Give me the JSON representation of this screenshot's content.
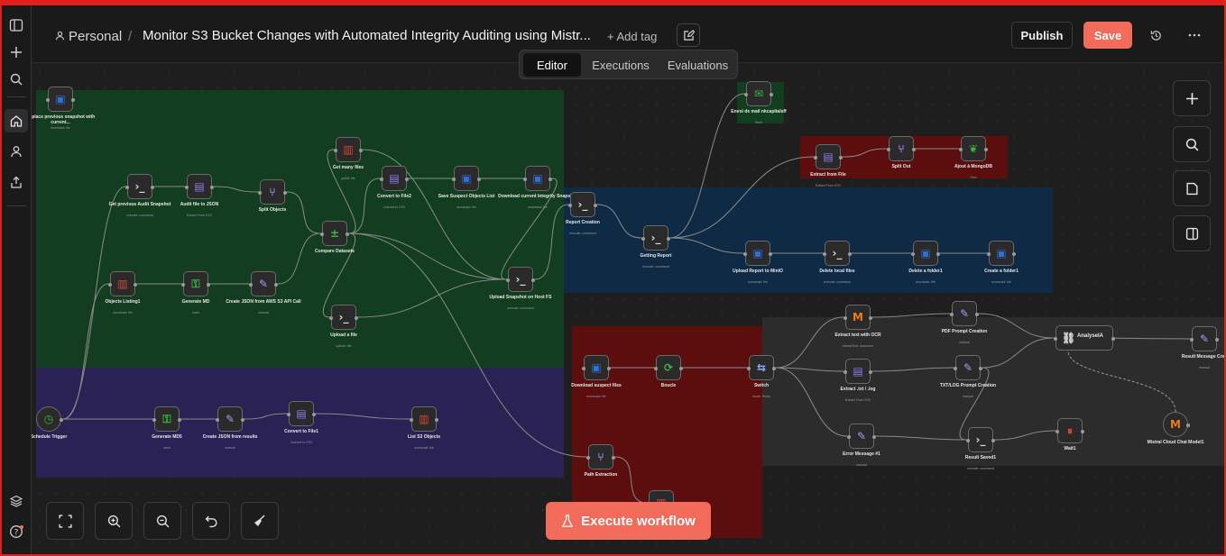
{
  "breadcrumb": {
    "project": "Personal",
    "separator": "/",
    "workflow_title": "Monitor S3 Bucket Changes with Automated Integrity Auditing using Mistr...",
    "add_tag": "+ Add tag"
  },
  "header": {
    "publish": "Publish",
    "save": "Save"
  },
  "tabs": [
    "Editor",
    "Executions",
    "Evaluations"
  ],
  "execute": "Execute workflow",
  "colors": {
    "accent": "#f26b5b",
    "sticky_green": "#123d1f",
    "sticky_purple": "#2a2155",
    "sticky_blue": "#0e2a44",
    "sticky_red": "#5c0d0d",
    "sticky_gray": "#2c2c2c"
  },
  "nodes": [
    {
      "id": "replace",
      "label": "Replace previous snapshot with current...",
      "sub": "download: file",
      "icon": "bucket-icon",
      "glyph": "▣",
      "color": "#2f6fd6"
    },
    {
      "id": "getprev",
      "label": "Get previous Audit Snapshot",
      "sub": "execute: command",
      "icon": "terminal-icon",
      "glyph": "›_",
      "color": "#dcdcdc"
    },
    {
      "id": "auditjson",
      "label": "Audit file to JSON",
      "sub": "Extract From CSV",
      "icon": "extract-icon",
      "glyph": "▤",
      "color": "#8e7cf0"
    },
    {
      "id": "split",
      "label": "Split Objects",
      "sub": "",
      "icon": "split-icon",
      "glyph": "⑂",
      "color": "#a27cf0"
    },
    {
      "id": "getmany",
      "label": "Get many files",
      "sub": "getAll: file",
      "icon": "aws-icon",
      "glyph": "▥",
      "color": "#d9443a"
    },
    {
      "id": "conv2",
      "label": "Convert to File2",
      "sub": "Convert to CSV",
      "icon": "file-icon",
      "glyph": "▤",
      "color": "#8e7cf0"
    },
    {
      "id": "savesusp",
      "label": "Save Suspect Objects List",
      "sub": "download: file",
      "icon": "bucket-icon",
      "glyph": "▣",
      "color": "#2f6fd6"
    },
    {
      "id": "dlcurrent",
      "label": "Download current Integrity Snapshot",
      "sub": "download: file",
      "icon": "bucket-icon",
      "glyph": "▣",
      "color": "#2f6fd6"
    },
    {
      "id": "compare",
      "label": "Compare Datasets",
      "sub": "",
      "icon": "compare-icon",
      "glyph": "±",
      "color": "#3ab54a"
    },
    {
      "id": "objlist",
      "label": "Objects Listing1",
      "sub": "download: file",
      "icon": "aws-icon",
      "glyph": "▥",
      "color": "#d9443a"
    },
    {
      "id": "genmd",
      "label": "Generate MD",
      "sub": "hash",
      "icon": "key-icon",
      "glyph": "⚿",
      "color": "#3ab54a"
    },
    {
      "id": "createjson",
      "label": "Create JSON from AWS S3 API Call",
      "sub": "manual",
      "icon": "pen-icon",
      "glyph": "✎",
      "color": "#a49cf5"
    },
    {
      "id": "uploadsnap",
      "label": "Upload Snapshot on Host FS",
      "sub": "execute: command",
      "icon": "terminal-icon",
      "glyph": "›_",
      "color": "#dcdcdc"
    },
    {
      "id": "uploadfile",
      "label": "Upload a file",
      "sub": "upload: file",
      "icon": "terminal-icon",
      "glyph": "›_",
      "color": "#dcdcdc"
    },
    {
      "id": "schedule",
      "label": "Schedule Trigger",
      "sub": "",
      "icon": "clock-icon",
      "glyph": "◷",
      "color": "#3ab54a"
    },
    {
      "id": "genmd5",
      "label": "Generate MD5",
      "sub": "hash",
      "icon": "key-icon",
      "glyph": "⚿",
      "color": "#3ab54a"
    },
    {
      "id": "createjson2",
      "label": "Create JSON from results",
      "sub": "manual",
      "icon": "pen-icon",
      "glyph": "✎",
      "color": "#a49cf5"
    },
    {
      "id": "conv1",
      "label": "Convert to File1",
      "sub": "Convert to CSV",
      "icon": "file-icon",
      "glyph": "▤",
      "color": "#8e7cf0"
    },
    {
      "id": "lists3",
      "label": "List S3 Objects",
      "sub": "download: file",
      "icon": "aws-icon",
      "glyph": "▥",
      "color": "#d9443a"
    },
    {
      "id": "envoi",
      "label": "Envoi de mail nkcapitalsff",
      "sub": "Send",
      "icon": "mail-icon",
      "glyph": "✉",
      "color": "#3ab54a"
    },
    {
      "id": "extractfile",
      "label": "Extract from File",
      "sub": "Extract From CSV",
      "icon": "extract-icon",
      "glyph": "▤",
      "color": "#8e7cf0"
    },
    {
      "id": "splitout",
      "label": "Split Out",
      "sub": "",
      "icon": "split-icon",
      "glyph": "⑂",
      "color": "#a27cf0"
    },
    {
      "id": "mongo",
      "label": "Ajout à MongoDB",
      "sub": "Find",
      "icon": "leaf-icon",
      "glyph": "❦",
      "color": "#3ab54a"
    },
    {
      "id": "report",
      "label": "Report Creation",
      "sub": "execute: command",
      "icon": "terminal-icon",
      "glyph": "›_",
      "color": "#dcdcdc"
    },
    {
      "id": "getreport",
      "label": "Getting Report",
      "sub": "execute: command",
      "icon": "terminal-icon",
      "glyph": "›_",
      "color": "#dcdcdc"
    },
    {
      "id": "uploadminio",
      "label": "Upload Report to MiniO",
      "sub": "download: file",
      "icon": "bucket-icon",
      "glyph": "▣",
      "color": "#2f6fd6"
    },
    {
      "id": "dellocal",
      "label": "Delete local files",
      "sub": "execute: command",
      "icon": "terminal-icon",
      "glyph": "›_",
      "color": "#dcdcdc"
    },
    {
      "id": "delfolder",
      "label": "Delete a folder1",
      "sub": "download: file",
      "icon": "bucket-icon",
      "glyph": "▣",
      "color": "#2f6fd6"
    },
    {
      "id": "createfolder",
      "label": "Create a folder1",
      "sub": "download: file",
      "icon": "bucket-icon",
      "glyph": "▣",
      "color": "#2f6fd6"
    },
    {
      "id": "dlsuspect",
      "label": "Download suspect files",
      "sub": "download: file",
      "icon": "bucket-icon",
      "glyph": "▣",
      "color": "#2f6fd6"
    },
    {
      "id": "boucle",
      "label": "Boucle",
      "sub": "",
      "icon": "loop-icon",
      "glyph": "⟳",
      "color": "#3ab54a"
    },
    {
      "id": "switch",
      "label": "Switch",
      "sub": "mode: Rules",
      "icon": "switch-icon",
      "glyph": "⇆",
      "color": "#8aa8ff"
    },
    {
      "id": "ocr",
      "label": "Extract text with OCR",
      "sub": "extractText: document",
      "icon": "mistral-icon",
      "glyph": "M",
      "color": "#f07a1a"
    },
    {
      "id": "txtlog",
      "label": "Extract .txt / .log",
      "sub": "Extract From CSV",
      "icon": "extract-icon",
      "glyph": "▤",
      "color": "#8e7cf0"
    },
    {
      "id": "pdfprompt",
      "label": "PDF Prompt Creation",
      "sub": "manual",
      "icon": "pen-icon",
      "glyph": "✎",
      "color": "#a49cf5"
    },
    {
      "id": "txtprompt",
      "label": "TXT/LOG Prompt Creation",
      "sub": "manual",
      "icon": "pen-icon",
      "glyph": "✎",
      "color": "#a49cf5"
    },
    {
      "id": "analysis",
      "label": "AnalyseIA",
      "sub": "",
      "icon": "link-icon",
      "glyph": "⛓",
      "color": "#dcdcdc"
    },
    {
      "id": "result",
      "label": "Result Message Crea",
      "sub": "manual",
      "icon": "pen-icon",
      "glyph": "✎",
      "color": "#a49cf5"
    },
    {
      "id": "mistral",
      "label": "Mistral Cloud Chat Model1",
      "sub": "",
      "icon": "mistral-icon",
      "glyph": "M",
      "color": "#f07a1a"
    },
    {
      "id": "errmsg",
      "label": "Error Message #1",
      "sub": "manual",
      "icon": "pen-icon",
      "glyph": "✎",
      "color": "#a49cf5"
    },
    {
      "id": "resultsaved",
      "label": "Result Saved1",
      "sub": "execute: command",
      "icon": "terminal-icon",
      "glyph": "›_",
      "color": "#dcdcdc"
    },
    {
      "id": "wait",
      "label": "Wait1",
      "sub": "",
      "icon": "pause-icon",
      "glyph": "⏸",
      "color": "#d9443a"
    },
    {
      "id": "pathext",
      "label": "Path Extraction",
      "sub": "",
      "icon": "split-icon",
      "glyph": "⑂",
      "color": "#a27cf0"
    },
    {
      "id": "bottomaws",
      "label": "",
      "sub": "",
      "icon": "aws-icon",
      "glyph": "▥",
      "color": "#d9443a"
    }
  ]
}
